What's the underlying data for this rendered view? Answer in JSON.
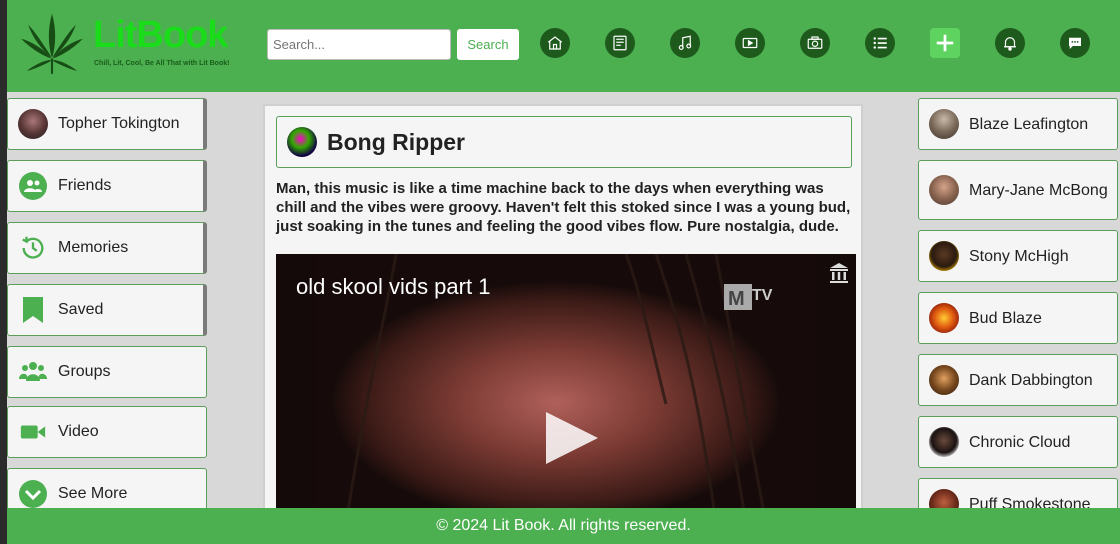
{
  "brand": {
    "title": "LitBook",
    "tagline": "Chill, Lit, Cool, Be All That with Lit Book!"
  },
  "search": {
    "placeholder": "Search...",
    "button_label": "Search"
  },
  "nav_icons": [
    "home-icon",
    "news-icon",
    "music-icon",
    "video-icon",
    "photo-icon",
    "list-icon",
    "add-icon",
    "bell-icon",
    "chat-icon"
  ],
  "left_sidebar": {
    "items": [
      {
        "label": "Topher Tokington",
        "icon": "avatar"
      },
      {
        "label": "Friends",
        "icon": "friends-icon"
      },
      {
        "label": "Memories",
        "icon": "clock-icon"
      },
      {
        "label": "Saved",
        "icon": "bookmark-icon"
      },
      {
        "label": "Groups",
        "icon": "groups-icon"
      },
      {
        "label": "Video",
        "icon": "video-camera-icon"
      },
      {
        "label": "See More",
        "icon": "chevron-down-icon"
      }
    ]
  },
  "post": {
    "author": "Bong Ripper",
    "text": "Man, this music is like a time machine back to the days when everything was chill and the vibes were groovy. Haven't felt this stoked since I was a young bud, just soaking in the tunes and feeling the good vibes flow. Pure nostalgia, dude.",
    "video_title": "old skool vids part 1"
  },
  "right_sidebar": {
    "friends": [
      {
        "name": "Blaze Leafington"
      },
      {
        "name": "Mary-Jane McBong"
      },
      {
        "name": "Stony McHigh"
      },
      {
        "name": "Bud Blaze"
      },
      {
        "name": "Dank Dabbington"
      },
      {
        "name": "Chronic Cloud"
      },
      {
        "name": "Puff Smokestone"
      }
    ]
  },
  "footer": {
    "text": "© 2024 Lit Book. All rights reserved."
  },
  "colors": {
    "brand_green": "#4caf50",
    "logo_green": "#1bdc1b",
    "nav_dark": "#1e5a1c",
    "accent_green": "#5fd35f"
  }
}
